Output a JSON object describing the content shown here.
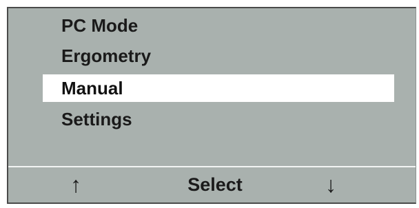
{
  "menu": {
    "items": [
      {
        "label": "PC Mode",
        "selected": false
      },
      {
        "label": "Ergometry",
        "selected": false
      },
      {
        "label": "Manual",
        "selected": true
      },
      {
        "label": "Settings",
        "selected": false
      }
    ]
  },
  "softkeys": {
    "up": "↑",
    "select": "Select",
    "down": "↓"
  },
  "colors": {
    "screen_background": "#a9b1ae",
    "selection_background": "#ffffff",
    "text": "#1a1a1a"
  }
}
